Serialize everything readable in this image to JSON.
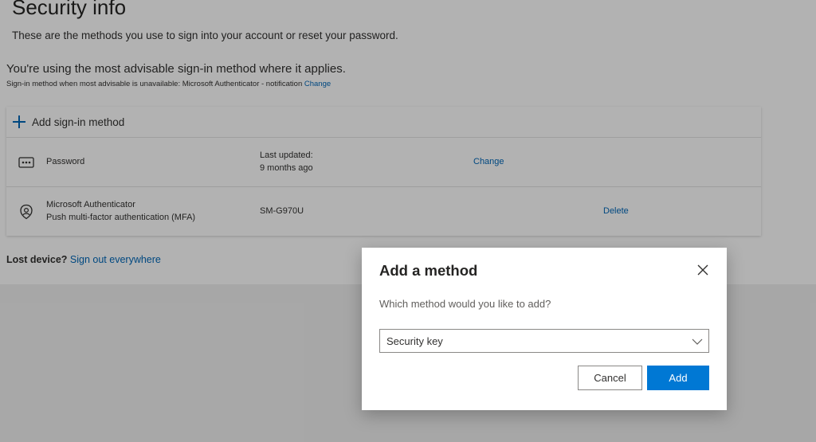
{
  "page": {
    "title": "Security info",
    "subtitle": "These are the methods you use to sign into your account or reset your password."
  },
  "advisable": {
    "heading": "You're using the most advisable sign-in method where it applies.",
    "note": "Sign-in method when most advisable is unavailable: Microsoft Authenticator - notification",
    "change_link": "Change"
  },
  "methods_card": {
    "add_label": "Add sign-in method",
    "rows": [
      {
        "icon": "password-dots-icon",
        "name": "Password",
        "detail_line1": "Last updated:",
        "detail_line2": "9 months ago",
        "action": "Change"
      },
      {
        "icon": "authenticator-icon",
        "name_line1": "Microsoft Authenticator",
        "name_line2": "Push multi-factor authentication (MFA)",
        "detail": "SM-G970U",
        "action": "Delete"
      }
    ]
  },
  "lost_device": {
    "label": "Lost device?",
    "link": "Sign out everywhere"
  },
  "dialog": {
    "title": "Add a method",
    "question": "Which method would you like to add?",
    "selected_method": "Security key",
    "cancel_label": "Cancel",
    "add_label": "Add"
  },
  "colors": {
    "link": "#0067b8",
    "primary_button": "#0078d4",
    "overlay": "rgba(0,0,0,0.30)"
  }
}
